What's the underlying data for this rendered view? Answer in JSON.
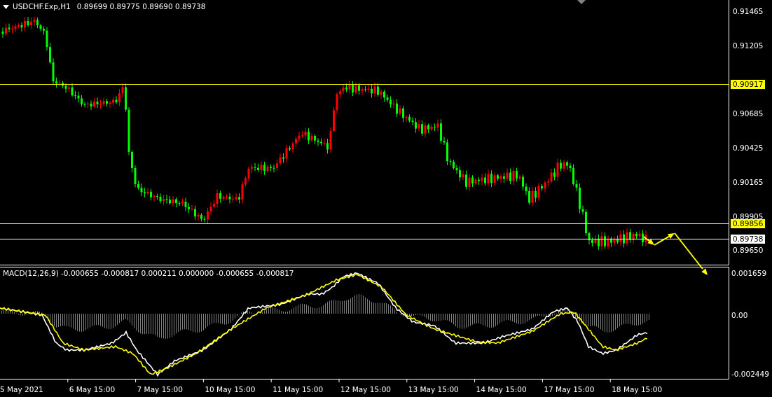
{
  "chart_header": {
    "symbol": "USDCHF.Exp,H1",
    "quote": "0.89699 0.89775 0.89690 0.89738"
  },
  "price_axis": {
    "ticks": [
      "0.91465",
      "0.91205",
      "0.90685",
      "0.90425",
      "0.90165",
      "0.89905",
      "0.89650"
    ]
  },
  "horizontal_lines": [
    {
      "price": "0.90917",
      "color": "#ffff00"
    },
    {
      "price": "0.89856",
      "color": "#ffff00"
    },
    {
      "price": "0.89738",
      "color": "#ffffff"
    }
  ],
  "macd": {
    "header": "MACD(12,26,9) -0.000655 -0.000817 0.000211 0.000000 -0.000655 -0.000817",
    "ticks": [
      "0.001659",
      "0.00",
      "-0.002449"
    ]
  },
  "time_axis": {
    "labels": [
      "5 May 2021",
      "6 May 15:00",
      "7 May 15:00",
      "10 May 15:00",
      "11 May 15:00",
      "12 May 15:00",
      "13 May 15:00",
      "14 May 15:00",
      "17 May 15:00",
      "18 May 15:00"
    ]
  }
}
